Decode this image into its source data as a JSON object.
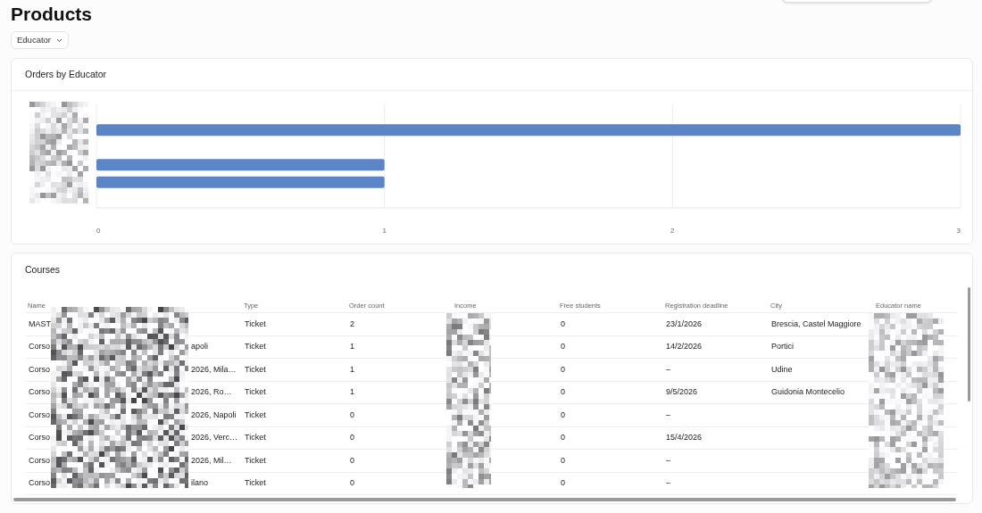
{
  "page": {
    "title": "Products"
  },
  "filter": {
    "label": "Educator"
  },
  "chart_card": {
    "title": "Orders by Educator",
    "chart_data": {
      "type": "bar",
      "orientation": "horizontal",
      "values": [
        null,
        3,
        null,
        1,
        1,
        null
      ],
      "xlim": [
        0,
        3
      ],
      "xticks": [
        0,
        1,
        2,
        3
      ],
      "color": "#5b85c6"
    }
  },
  "table_card": {
    "title": "Courses",
    "columns": [
      "Name",
      "Type",
      "Order count",
      "Income",
      "Free students",
      "Registration deadline",
      "City",
      "Educator name"
    ],
    "rows": [
      {
        "name_start": "MAST",
        "type": "Ticket",
        "order_count": "2",
        "free_students": "0",
        "registration_deadline": "23/1/2026",
        "city": "Brescia, Castel Maggiore"
      },
      {
        "name_start": "Corso",
        "name_end": "apoli",
        "type": "Ticket",
        "order_count": "1",
        "free_students": "0",
        "registration_deadline": "14/2/2026",
        "city": "Portici"
      },
      {
        "name_start": "Corso",
        "name_end": "2026, Mila…",
        "type": "Ticket",
        "order_count": "1",
        "free_students": "0",
        "registration_deadline": "–",
        "city": "Udine"
      },
      {
        "name_start": "Corso",
        "name_end": "2026, Ro…",
        "type": "Ticket",
        "order_count": "1",
        "free_students": "0",
        "registration_deadline": "9/5/2026",
        "city": "Guidonia Montecelio"
      },
      {
        "name_start": "Corso",
        "name_end": "2026, Napoli",
        "type": "Ticket",
        "order_count": "0",
        "free_students": "0",
        "registration_deadline": "–"
      },
      {
        "name_start": "Corso",
        "name_end": "2026, Verc…",
        "type": "Ticket",
        "order_count": "0",
        "free_students": "0",
        "registration_deadline": "15/4/2026"
      },
      {
        "name_start": "Corso",
        "name_end": "2026, Mil…",
        "type": "Ticket",
        "order_count": "0",
        "free_students": "0",
        "registration_deadline": "–"
      },
      {
        "name_start": "Corso",
        "name_end": "ilano",
        "type": "Ticket",
        "order_count": "0",
        "free_students": "0",
        "registration_deadline": "–"
      }
    ]
  }
}
